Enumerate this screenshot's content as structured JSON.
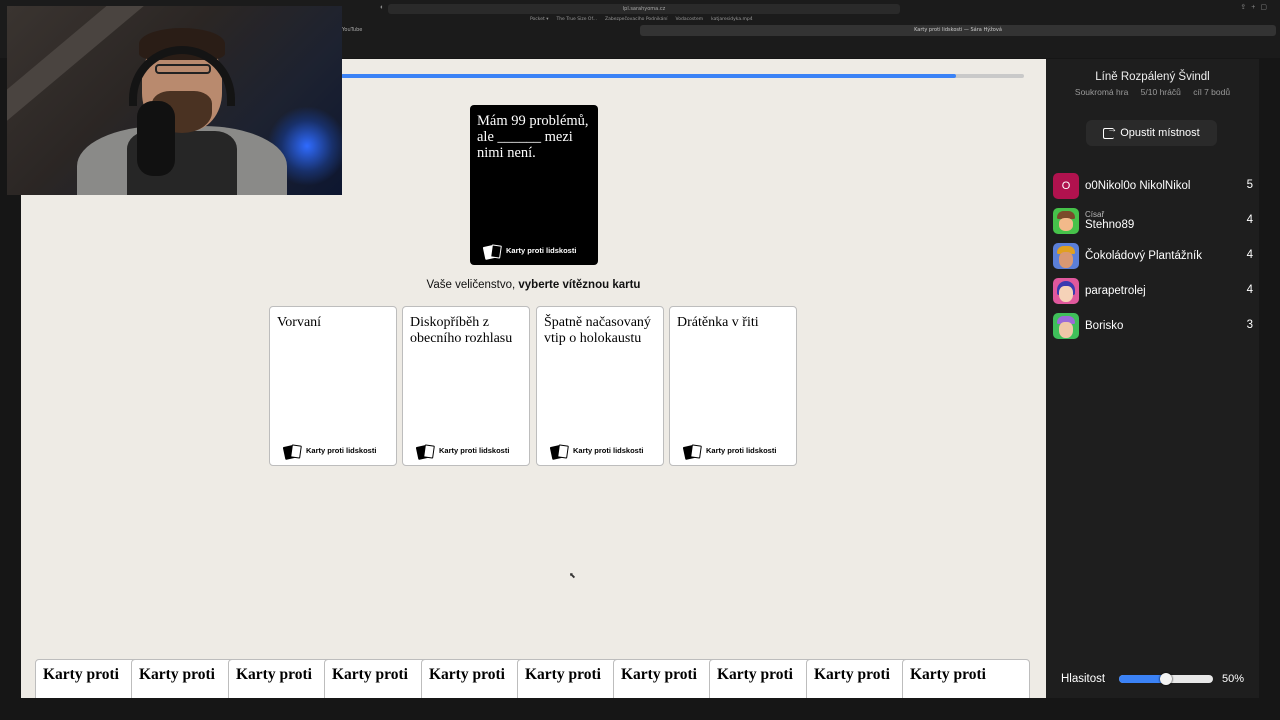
{
  "browser": {
    "url": "lpl.sarahyoma.cz",
    "bookmarks": [
      "Pocket ▾",
      "The True Size Of...",
      "Zabezpečovacího Podnikání",
      "Vodacostem",
      "katjaresidyka.mp4"
    ],
    "left_tab": "YouTube",
    "active_tab": "Karty proti lidskosti — Sára Hýžová"
  },
  "game": {
    "progress_fraction": 0.9,
    "black_card": {
      "text": "Mám 99 problémů, ale ______ mezi nimi není.",
      "footer": "Karty proti lidskosti"
    },
    "prompt_normal": "Vaše veličenstvo, ",
    "prompt_bold": "vyberte vítěznou kartu",
    "white_cards": [
      {
        "text": "Vorvaní",
        "footer": "Karty proti lidskosti"
      },
      {
        "text": "Diskopříběh z obecního rozhlasu",
        "footer": "Karty proti lidskosti"
      },
      {
        "text": "Špatně načasovaný vtip o holokaustu",
        "footer": "Karty proti lidskosti"
      },
      {
        "text": "Drátěnka v řiti",
        "footer": "Karty proti lidskosti"
      }
    ],
    "hand_cards": [
      "Karty proti",
      "Karty proti",
      "Karty proti",
      "Karty proti",
      "Karty proti",
      "Karty proti",
      "Karty proti",
      "Karty proti",
      "Karty proti",
      "Karty proti"
    ]
  },
  "sidebar": {
    "room_name": "Líně Rozpálený Švindl",
    "room_type": "Soukromá hra",
    "player_count": "5/10 hráčů",
    "goal": "cíl 7 bodů",
    "leave_button": "Opustit místnost",
    "players": [
      {
        "title": "",
        "name": "o0Nikol0o NikolNikol",
        "score": "5",
        "avatar_letter": "O",
        "avatar_bg": "#b0124e"
      },
      {
        "title": "Císař",
        "name": "Stehno89",
        "score": "4",
        "avatar_letter": "",
        "avatar_bg": "#46c24a"
      },
      {
        "title": "",
        "name": "Čokoládový Plantážník",
        "score": "4",
        "avatar_letter": "",
        "avatar_bg": "#5b7fd8"
      },
      {
        "title": "",
        "name": "parapetrolej",
        "score": "4",
        "avatar_letter": "",
        "avatar_bg": "#e0589d"
      },
      {
        "title": "",
        "name": "Borisko",
        "score": "3",
        "avatar_letter": "",
        "avatar_bg": "#3fbf5a"
      }
    ],
    "volume_label": "Hlasitost",
    "volume_percent": "50%",
    "volume_fraction": 0.5
  },
  "colors": {
    "accent": "#3b82f6",
    "game_bg": "#eeebe5",
    "sidebar_bg": "#1e1e1e"
  },
  "icons": [
    "leave-room-icon",
    "cards-logo-icon",
    "share-icon",
    "new-tab-icon",
    "mouse-cursor-icon"
  ]
}
